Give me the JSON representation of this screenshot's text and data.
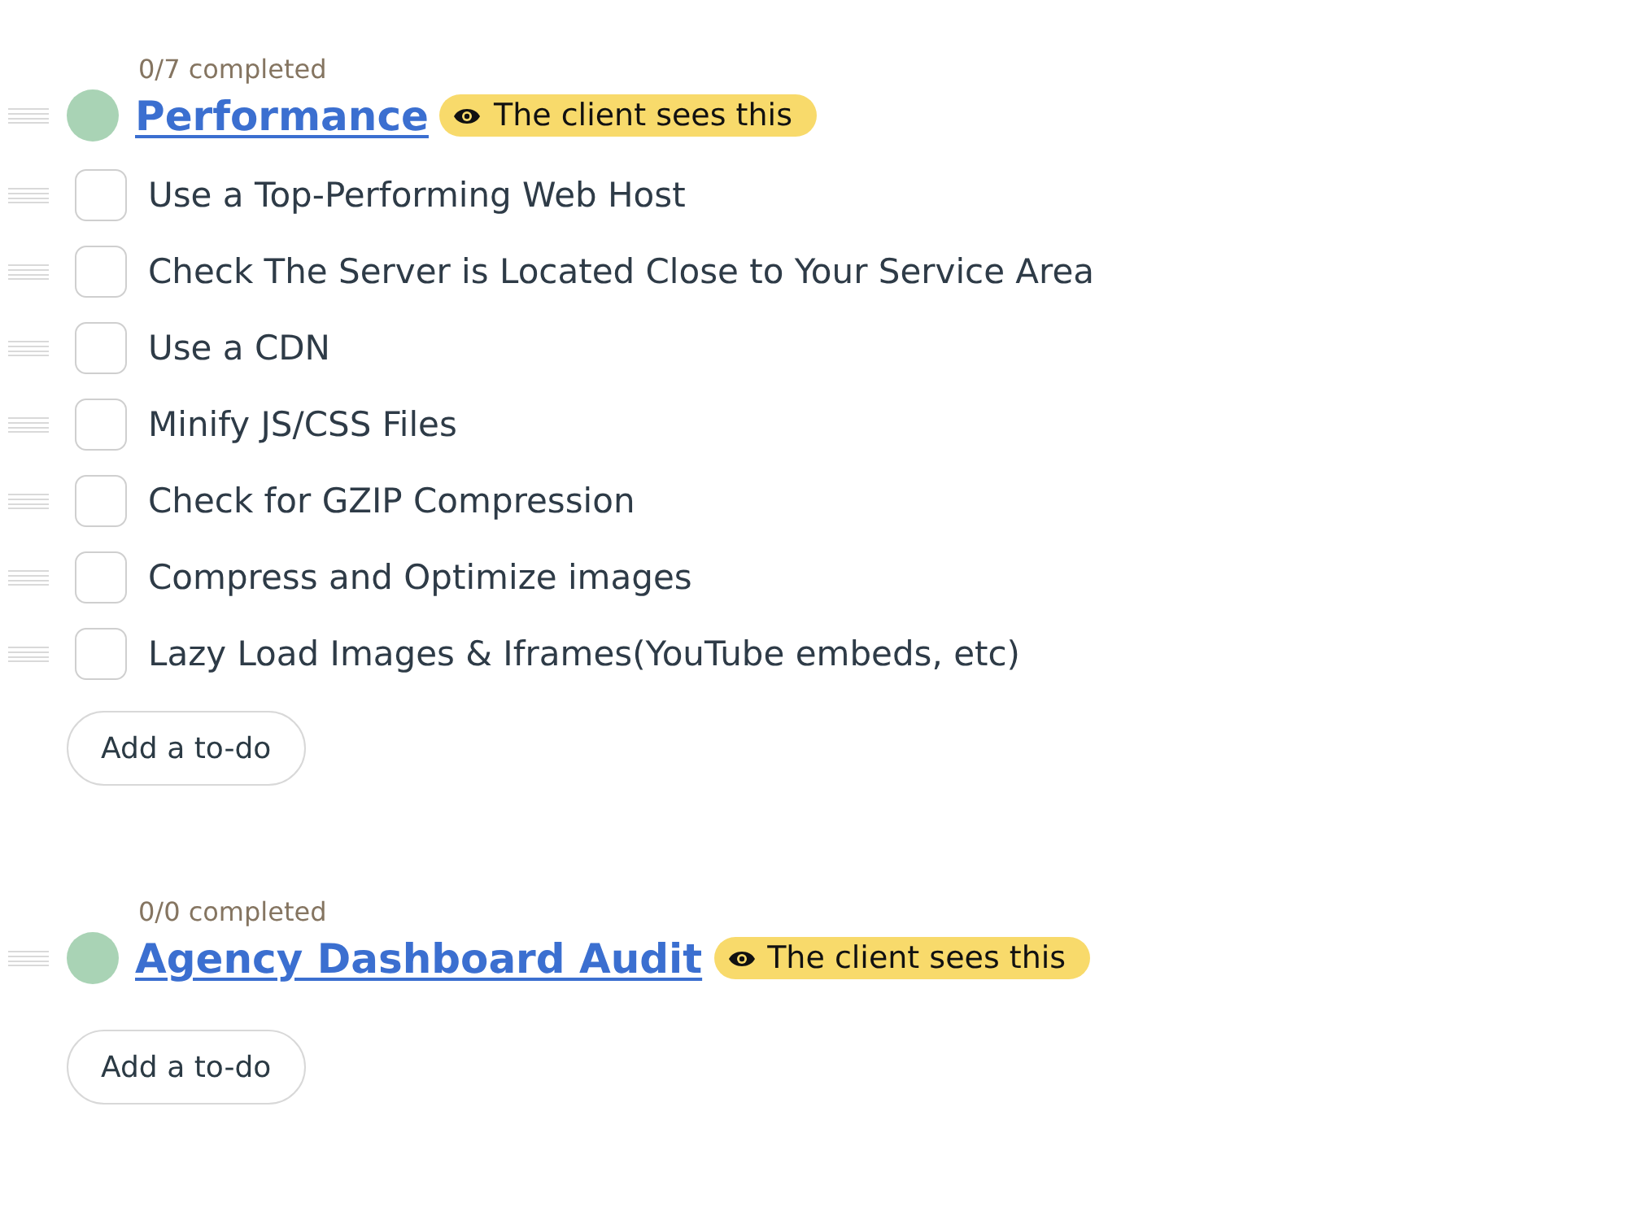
{
  "lists": [
    {
      "progress": "0/7 completed",
      "color": "#a9d3b5",
      "title": "Performance",
      "visibility_badge": "The client sees this",
      "todos": [
        {
          "label": "Use a Top-Performing Web Host",
          "checked": false
        },
        {
          "label": "Check The Server is Located Close to Your Service Area",
          "checked": false
        },
        {
          "label": "Use a CDN",
          "checked": false
        },
        {
          "label": "Minify JS/CSS Files",
          "checked": false
        },
        {
          "label": "Check for GZIP Compression",
          "checked": false
        },
        {
          "label": "Compress and Optimize images",
          "checked": false
        },
        {
          "label": "Lazy Load Images & Iframes(YouTube embeds, etc)",
          "checked": false
        }
      ],
      "add_button": "Add a to-do"
    },
    {
      "progress": "0/0 completed",
      "color": "#a9d3b5",
      "title": "Agency Dashboard Audit",
      "visibility_badge": "The client sees this",
      "add_button": "Add a to-do"
    }
  ]
}
